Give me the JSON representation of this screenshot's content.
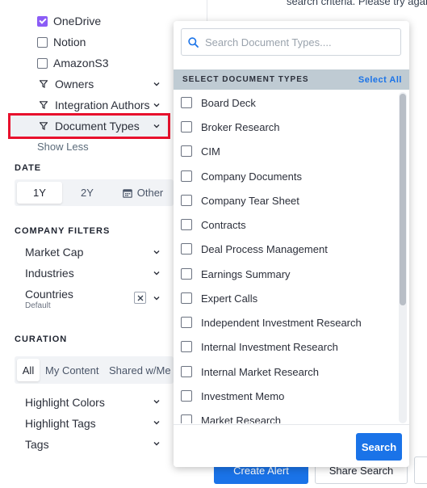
{
  "top_hint": "search criteria. Please try again",
  "sidebar": {
    "sources": [
      {
        "label": "OneDrive",
        "checked": true
      },
      {
        "label": "Notion",
        "checked": false
      },
      {
        "label": "AmazonS3",
        "checked": false
      }
    ],
    "filters": [
      {
        "label": "Owners"
      },
      {
        "label": "Integration Authors"
      },
      {
        "label": "Document Types"
      }
    ],
    "show_less": "Show Less",
    "date": {
      "title": "DATE",
      "options": [
        "1Y",
        "2Y",
        "Other"
      ],
      "selected": "1Y"
    },
    "company_filters": {
      "title": "COMPANY FILTERS",
      "items": [
        "Market Cap",
        "Industries",
        "Countries"
      ],
      "countries_sub": "Default"
    },
    "curation": {
      "title": "CURATION",
      "tabs": [
        "All",
        "My Content",
        "Shared w/Me"
      ],
      "selected": "All",
      "items": [
        "Highlight Colors",
        "Highlight Tags",
        "Tags"
      ]
    }
  },
  "bottom_buttons": {
    "create_alert": "Create Alert",
    "share_search": "Share Search"
  },
  "dropdown": {
    "search_placeholder": "Search Document Types....",
    "header": "SELECT DOCUMENT TYPES",
    "select_all": "Select All",
    "items": [
      "Board Deck",
      "Broker Research",
      "CIM",
      "Company Documents",
      "Company Tear Sheet",
      "Contracts",
      "Deal Process Management",
      "Earnings Summary",
      "Expert Calls",
      "Independent Investment Research",
      "Internal Investment Research",
      "Internal Market Research",
      "Investment Memo",
      "Market Research"
    ],
    "search_button": "Search"
  },
  "colors": {
    "accent": "#1a73e8",
    "checked": "#8b5cf6",
    "highlight_border": "#e8112d",
    "header_bg": "#bfcbd3"
  }
}
